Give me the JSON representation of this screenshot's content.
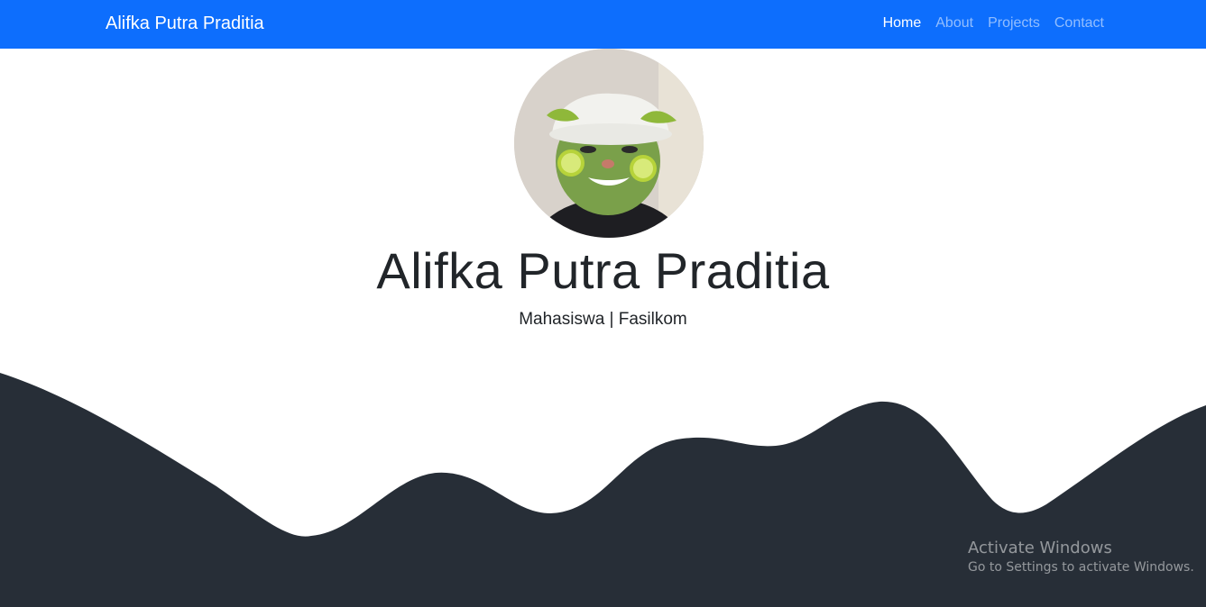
{
  "navbar": {
    "brand": "Alifka Putra Praditia",
    "links": [
      {
        "label": "Home",
        "active": true
      },
      {
        "label": "About",
        "active": false
      },
      {
        "label": "Projects",
        "active": false
      },
      {
        "label": "Contact",
        "active": false
      }
    ],
    "bg_color": "#0d6efd"
  },
  "hero": {
    "name": "Alifka Putra Praditia",
    "subtitle": "Mahasiswa | Fasilkom",
    "avatar_icon": "profile-photo"
  },
  "wave": {
    "color": "#272e37"
  },
  "watermark": {
    "title": "Activate Windows",
    "subtitle": "Go to Settings to activate Windows."
  }
}
